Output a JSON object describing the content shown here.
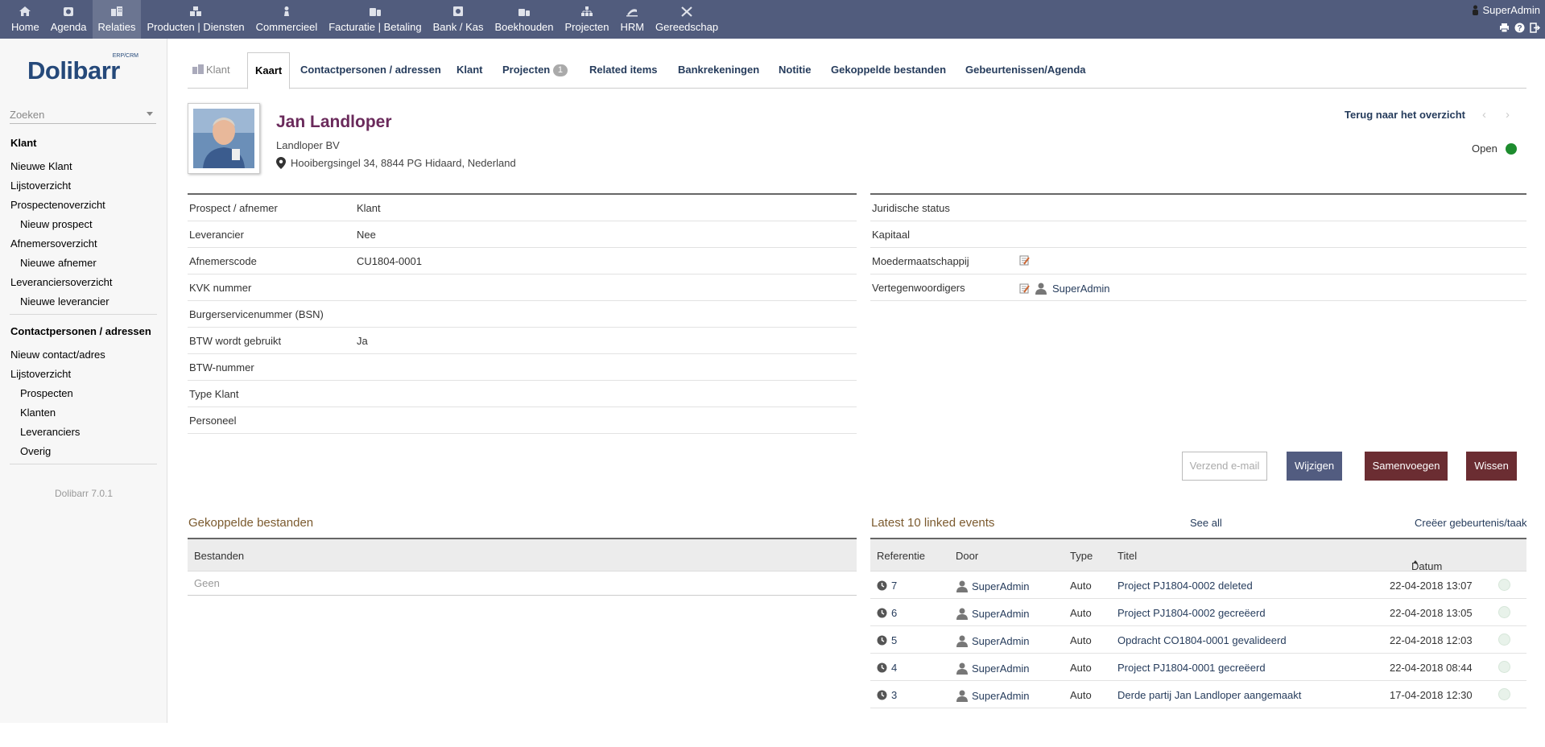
{
  "topmenu": [
    {
      "label": "Home",
      "icon": "home-icon"
    },
    {
      "label": "Agenda",
      "icon": "agenda-icon"
    },
    {
      "label": "Relaties",
      "icon": "relations-icon",
      "active": true
    },
    {
      "label": "Producten | Diensten",
      "icon": "products-icon"
    },
    {
      "label": "Commercieel",
      "icon": "commercial-icon"
    },
    {
      "label": "Facturatie | Betaling",
      "icon": "billing-icon"
    },
    {
      "label": "Bank / Kas",
      "icon": "bank-icon"
    },
    {
      "label": "Boekhouden",
      "icon": "accounting-icon"
    },
    {
      "label": "Projecten",
      "icon": "projects-icon"
    },
    {
      "label": "HRM",
      "icon": "hrm-icon"
    },
    {
      "label": "Gereedschap",
      "icon": "tools-icon"
    }
  ],
  "user": {
    "name": "SuperAdmin"
  },
  "logo": {
    "text": "Dolibarr",
    "sub": "ERP/CRM"
  },
  "search": {
    "placeholder": "Zoeken"
  },
  "leftmenu": {
    "group1": [
      {
        "label": "Klant",
        "type": "head"
      },
      {
        "label": "Nieuwe Klant",
        "type": "item"
      },
      {
        "label": "Lijstoverzicht",
        "type": "item"
      },
      {
        "label": "Prospectenoverzicht",
        "type": "item"
      },
      {
        "label": "Nieuw prospect",
        "type": "sub"
      },
      {
        "label": "Afnemersoverzicht",
        "type": "item"
      },
      {
        "label": "Nieuwe afnemer",
        "type": "sub"
      },
      {
        "label": "Leveranciersoverzicht",
        "type": "item"
      },
      {
        "label": "Nieuwe leverancier",
        "type": "sub"
      }
    ],
    "group2": [
      {
        "label": "Contactpersonen / adressen",
        "type": "head"
      },
      {
        "label": "Nieuw contact/adres",
        "type": "item"
      },
      {
        "label": "Lijstoverzicht",
        "type": "item"
      },
      {
        "label": "Prospecten",
        "type": "sub"
      },
      {
        "label": "Klanten",
        "type": "sub"
      },
      {
        "label": "Leveranciers",
        "type": "sub"
      },
      {
        "label": "Overig",
        "type": "sub"
      }
    ],
    "version": "Dolibarr 7.0.1"
  },
  "tabs": [
    {
      "label": "Klant"
    },
    {
      "label": "Kaart"
    },
    {
      "label": "Contactpersonen / adressen"
    },
    {
      "label": "Klant"
    },
    {
      "label": "Projecten",
      "badge": "1"
    },
    {
      "label": "Related items"
    },
    {
      "label": "Bankrekeningen"
    },
    {
      "label": "Notitie"
    },
    {
      "label": "Gekoppelde bestanden"
    },
    {
      "label": "Gebeurtenissen/Agenda"
    }
  ],
  "header": {
    "name": "Jan Landloper",
    "company": "Landloper BV",
    "address": "Hooibergsingel 34, 8844 PG Hidaard, Nederland",
    "back": "Terug naar het overzicht",
    "prev": "‹",
    "next": "›",
    "status": "Open",
    "status_color": "#1d8c2e"
  },
  "fields_left": [
    {
      "label": "Prospect / afnemer",
      "value": "Klant"
    },
    {
      "label": "Leverancier",
      "value": "Nee"
    },
    {
      "label": "Afnemerscode",
      "value": "CU1804-0001"
    },
    {
      "label": "KVK nummer",
      "value": ""
    },
    {
      "label": "Burgerservicenummer (BSN)",
      "value": ""
    },
    {
      "label": "BTW wordt gebruikt",
      "value": "Ja"
    },
    {
      "label": "BTW-nummer",
      "value": ""
    },
    {
      "label": "Type Klant",
      "value": ""
    },
    {
      "label": "Personeel",
      "value": ""
    }
  ],
  "fields_right": [
    {
      "label": "Juridische status",
      "value": ""
    },
    {
      "label": "Kapitaal",
      "value": ""
    },
    {
      "label": "Moedermaatschappij",
      "value": "",
      "edit": true
    },
    {
      "label": "Vertegenwoordigers",
      "value": "SuperAdmin",
      "edit": true,
      "user": true
    }
  ],
  "actions": {
    "email": "Verzend e-mail",
    "modify": "Wijzigen",
    "merge": "Samenvoegen",
    "delete": "Wissen"
  },
  "files": {
    "title": "Gekoppelde bestanden",
    "header": "Bestanden",
    "empty": "Geen"
  },
  "events": {
    "title": "Latest 10 linked events",
    "see_all": "See all",
    "create": "Creëer gebeurtenis/taak",
    "columns": {
      "ref": "Referentie",
      "by": "Door",
      "type": "Type",
      "title": "Titel",
      "date": "Datum"
    },
    "rows": [
      {
        "ref": "7",
        "by": "SuperAdmin",
        "type": "Auto",
        "title": "Project PJ1804-0002 deleted",
        "date": "22-04-2018 13:07"
      },
      {
        "ref": "6",
        "by": "SuperAdmin",
        "type": "Auto",
        "title": "Project PJ1804-0002 gecreëerd",
        "date": "22-04-2018 13:05"
      },
      {
        "ref": "5",
        "by": "SuperAdmin",
        "type": "Auto",
        "title": "Opdracht CO1804-0001 gevalideerd",
        "date": "22-04-2018 12:03"
      },
      {
        "ref": "4",
        "by": "SuperAdmin",
        "type": "Auto",
        "title": "Project PJ1804-0001 gecreëerd",
        "date": "22-04-2018 08:44"
      },
      {
        "ref": "3",
        "by": "SuperAdmin",
        "type": "Auto",
        "title": "Derde partij Jan Landloper aangemaakt",
        "date": "17-04-2018 12:30"
      }
    ]
  },
  "colors": {
    "topbar": "#515c7d",
    "title": "#6a2a5b",
    "link": "#263c5c",
    "btn_blue": "#525c80",
    "btn_red": "#6b2d32"
  }
}
